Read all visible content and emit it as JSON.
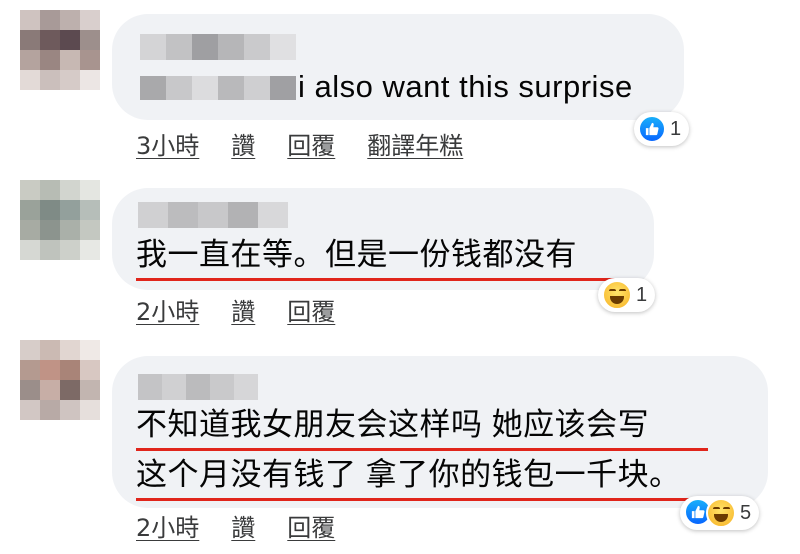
{
  "comments": [
    {
      "text": "i also want this surprise",
      "meta": {
        "time": "3小時",
        "like": "讚",
        "reply": "回覆",
        "translate": "翻譯年糕"
      },
      "reaction": {
        "icons": [
          "like-icon"
        ],
        "count": "1"
      }
    },
    {
      "text": "我一直在等。但是一份钱都没有",
      "meta": {
        "time": "2小時",
        "like": "讚",
        "reply": "回覆"
      },
      "reaction": {
        "icons": [
          "haha-icon"
        ],
        "count": "1"
      }
    },
    {
      "text_line1": "不知道我女朋友会这样吗 她应该会写",
      "text_line2": "这个月没有钱了 拿了你的钱包一千块。",
      "meta": {
        "time": "2小時",
        "like": "讚",
        "reply": "回覆"
      },
      "reaction": {
        "icons": [
          "like-icon",
          "haha-icon"
        ],
        "count": "5"
      }
    }
  ],
  "colors": {
    "bubble": "#f0f2f5",
    "underline": "#e0251b",
    "like": "#0866ff",
    "haha": "#f7b125"
  }
}
